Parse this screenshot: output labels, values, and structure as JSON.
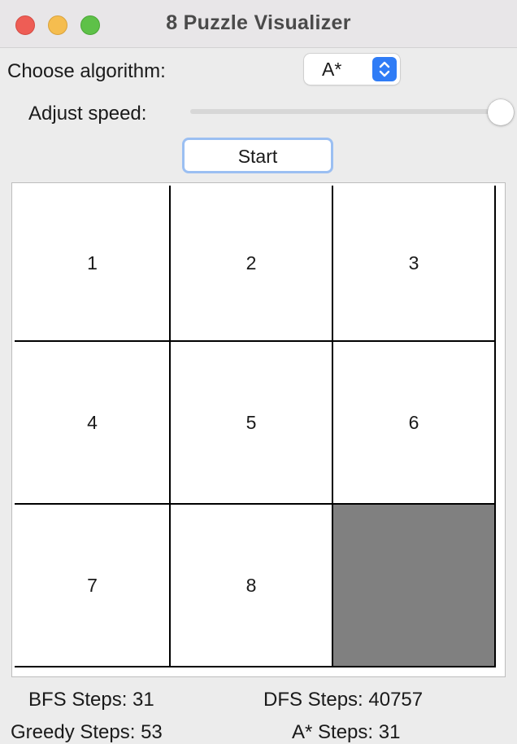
{
  "window": {
    "title": "8 Puzzle Visualizer"
  },
  "controls": {
    "algorithm_label": "Choose algorithm:",
    "algorithm_value": "A*",
    "speed_label": "Adjust speed:",
    "speed_level": 1.0,
    "start_label": "Start"
  },
  "board": {
    "tiles": [
      "1",
      "2",
      "3",
      "4",
      "5",
      "6",
      "7",
      "8",
      ""
    ],
    "blank_color": "#808080"
  },
  "stats": {
    "bfs": "BFS Steps: 31",
    "dfs": "DFS Steps: 40757",
    "greedy": "Greedy Steps: 53",
    "astar": "A* Steps: 31"
  },
  "colors": {
    "accent": "#2f7cf6",
    "focus_ring": "#9bbff2"
  }
}
